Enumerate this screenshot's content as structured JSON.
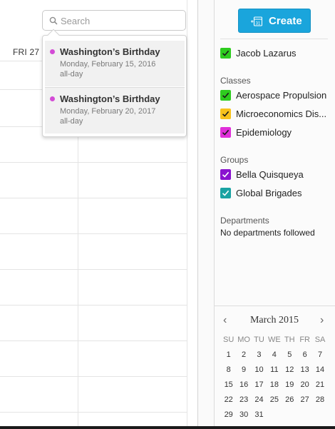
{
  "search": {
    "placeholder": "Search"
  },
  "calendar": {
    "day_header": "FRI 27"
  },
  "search_results": [
    {
      "title": "Washington’s Birthday",
      "date": "Monday, February 15, 2016",
      "duration": "all-day",
      "dot_color": "#d34bd6"
    },
    {
      "title": "Washington’s Birthday",
      "date": "Monday, February 20, 2017",
      "duration": "all-day",
      "dot_color": "#d34bd6"
    }
  ],
  "sidebar": {
    "create_label": "Create",
    "create_icon_text": "+31",
    "personal": {
      "label": "Jacob Lazarus",
      "color": "#2ecc1f",
      "checked": true
    },
    "classes": {
      "heading": "Classes",
      "items": [
        {
          "label": "Aerospace Propulsion",
          "color": "#2ecc1f",
          "checked": true
        },
        {
          "label": "Microeconomics Dis...",
          "color": "#f7c21b",
          "checked": true
        },
        {
          "label": "Epidemiology",
          "color": "#e02fd9",
          "checked": true
        }
      ]
    },
    "groups": {
      "heading": "Groups",
      "items": [
        {
          "label": "Bella Quisqueya",
          "color": "#8a12cf",
          "checked": true
        },
        {
          "label": "Global Brigades",
          "color": "#1aa3a3",
          "checked": true
        }
      ]
    },
    "departments": {
      "heading": "Departments",
      "empty_text": "No departments followed"
    }
  },
  "mini_calendar": {
    "prev": "‹",
    "next": "›",
    "title": "March 2015",
    "weekdays": [
      "SU",
      "MO",
      "TU",
      "WE",
      "TH",
      "FR",
      "SA"
    ],
    "weeks": [
      [
        "1",
        "2",
        "3",
        "4",
        "5",
        "6",
        "7"
      ],
      [
        "8",
        "9",
        "10",
        "11",
        "12",
        "13",
        "14"
      ],
      [
        "15",
        "16",
        "17",
        "18",
        "19",
        "20",
        "21"
      ],
      [
        "22",
        "23",
        "24",
        "25",
        "26",
        "27",
        "28"
      ],
      [
        "29",
        "30",
        "31",
        "",
        "",
        "",
        ""
      ]
    ]
  }
}
